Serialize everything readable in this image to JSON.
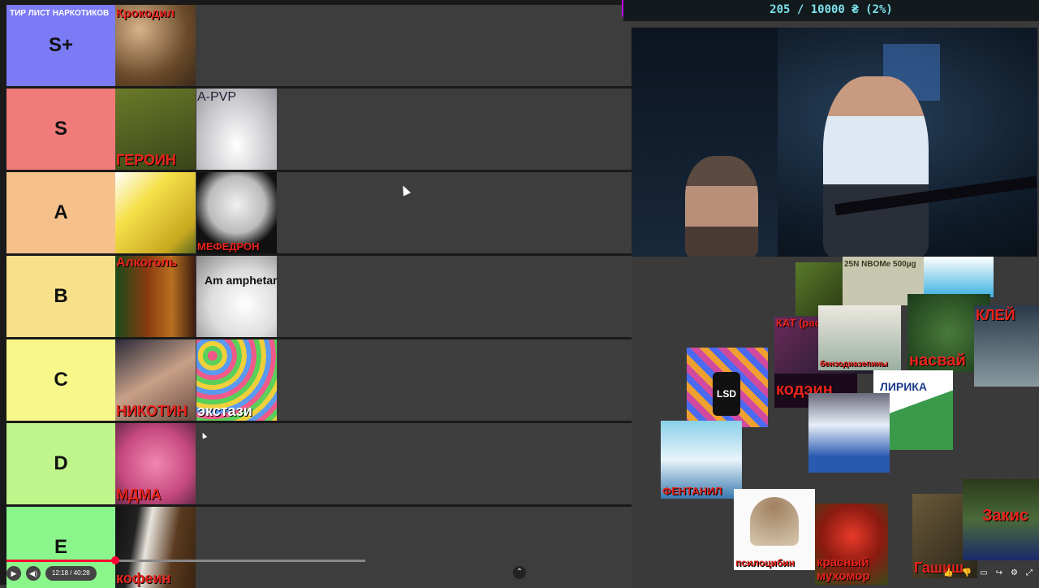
{
  "stream_goal": {
    "text": "205 / 10000 ₴ (2%)",
    "progress_fraction": 0.0205,
    "accent": "#c000ff",
    "text_color": "#7ce0e8"
  },
  "tierlist": {
    "title": "ТИР ЛИСТ НАРКОТИКОВ",
    "tiers": [
      {
        "label": "S+",
        "color": "#7b7bf5",
        "items": [
          {
            "caption": "Крокодил",
            "icon": "krokodil-image"
          }
        ]
      },
      {
        "label": "S",
        "color": "#f17a7a",
        "items": [
          {
            "caption": "ГЕРОИН",
            "icon": "heroin-image"
          },
          {
            "caption": "A-PVP",
            "icon": "apvp-image"
          }
        ]
      },
      {
        "label": "A",
        "color": "#f5c08a",
        "items": [
          {
            "caption": "",
            "icon": "spice-image"
          },
          {
            "caption": "МЕФЕДРОН",
            "icon": "mephedrone-image"
          }
        ]
      },
      {
        "label": "B",
        "color": "#f8e08a",
        "items": [
          {
            "caption": "Алкоголь",
            "icon": "alcohol-image"
          },
          {
            "caption": "Am amphetamine",
            "icon": "amphetamine-image"
          }
        ]
      },
      {
        "label": "C",
        "color": "#f7f78a",
        "items": [
          {
            "caption": "НИКОТИН",
            "icon": "nicotine-image"
          },
          {
            "caption": "экстази",
            "icon": "ecstasy-image"
          }
        ]
      },
      {
        "label": "D",
        "color": "#bff58a",
        "items": [
          {
            "caption": "МДМА",
            "icon": "mdma-image"
          }
        ]
      },
      {
        "label": "E",
        "color": "#8af58a",
        "items": [
          {
            "caption": "кофеин",
            "icon": "caffeine-image"
          }
        ]
      }
    ]
  },
  "unranked": {
    "kat": "КАТ (растение)",
    "benzo": "бензодиазепины",
    "nasvay": "насвай",
    "kodein": "кодэин",
    "lirika": "ЛИРИКА",
    "fentanyl": "ФЕНТАНИЛ",
    "psilocybin": "псилоцибин",
    "amanita": "красный мухомор",
    "hashish": "Гашиш",
    "clay": "КЛЕЙ",
    "lsd": "LSD",
    "nbome": "25N NBOMe 500µg",
    "zakis": "Закис"
  },
  "player": {
    "time": "12:18 / 40:28",
    "progress_fraction": 0.304,
    "accent": "#ff0033"
  }
}
